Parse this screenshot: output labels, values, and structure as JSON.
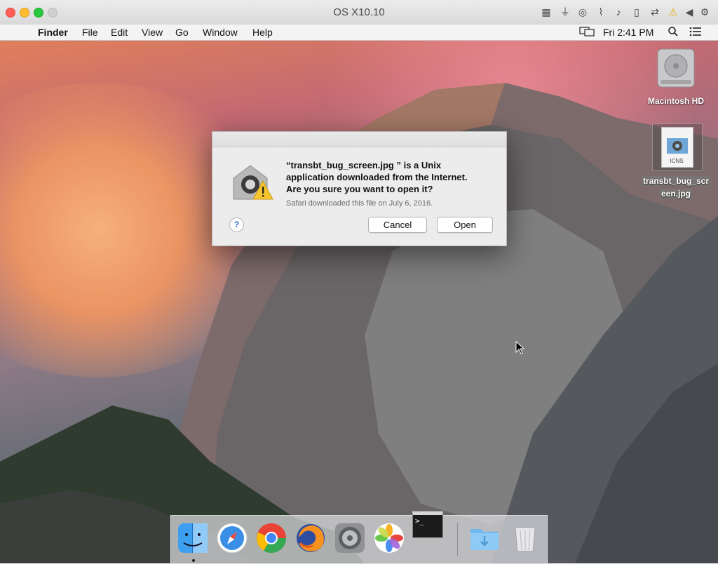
{
  "host_window": {
    "title": "OS X10.10",
    "traffic_lights": {
      "close": "#ff5f57",
      "minimize": "#febc2e",
      "zoom": "#28c840",
      "fullscreen": "#cfcfcf"
    },
    "toolbar_icons": [
      "keyboard-icon",
      "usb-icon",
      "cd-icon",
      "network-icon",
      "sound-icon",
      "phone-icon",
      "screen-share-icon",
      "warning-icon",
      "arrow-left-icon",
      "gear-icon"
    ]
  },
  "menu_bar": {
    "app_name": "Finder",
    "items": [
      "File",
      "Edit",
      "View",
      "Go",
      "Window",
      "Help"
    ],
    "clock": "Fri 2:41 PM"
  },
  "desktop_icons": [
    {
      "name": "macintosh-hd",
      "label": "Macintosh HD"
    },
    {
      "name": "transbt-file",
      "label_line1": "transbt_bug_scr",
      "label_line2": "een.jpg",
      "badge": "ICNS"
    }
  ],
  "dialog": {
    "message_line1": "“transbt_bug_screen.jpg ” is a Unix",
    "message_line2": "application downloaded from the Internet.",
    "message_line3": "Are you sure you want to open it?",
    "info": "Safari downloaded this file on July 6, 2016.",
    "help_label": "?",
    "cancel_label": "Cancel",
    "open_label": "Open"
  },
  "dock": {
    "apps": [
      "Finder",
      "Safari",
      "Chrome",
      "Firefox",
      "System Preferences",
      "Photos",
      "Terminal",
      "Downloads",
      "Trash"
    ],
    "terminal_prompt": ">_"
  }
}
